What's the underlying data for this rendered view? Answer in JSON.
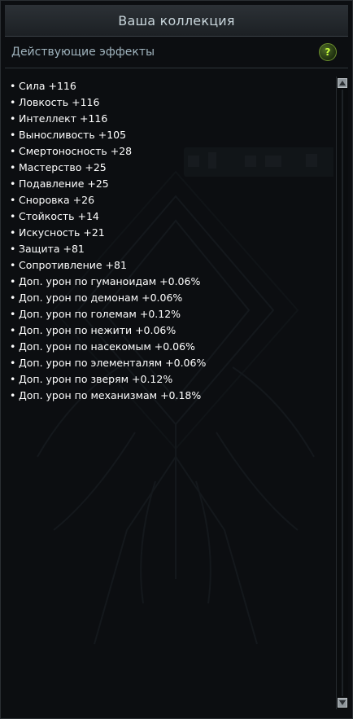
{
  "window": {
    "title": "Ваша коллекция"
  },
  "section": {
    "title": "Действующие эффекты",
    "help_label": "?"
  },
  "effects": [
    "Сила +116",
    "Ловкость +116",
    "Интеллект +116",
    "Выносливость +105",
    "Смертоносность +28",
    "Мастерство +25",
    "Подавление +25",
    "Сноровка +26",
    "Стойкость +14",
    "Искусность +21",
    "Защита +81",
    "Сопротивление +81",
    "Доп. урон по гуманоидам +0.06%",
    "Доп. урон по демонам +0.06%",
    "Доп. урон по големам +0.12%",
    "Доп. урон по нежити +0.06%",
    "Доп. урон по насекомым +0.06%",
    "Доп. урон по элементалям +0.06%",
    "Доп. урон по зверям +0.12%",
    "Доп. урон по механизмам +0.18%"
  ],
  "icons": {
    "help": "question-mark-icon",
    "scroll_up": "arrow-up-icon",
    "scroll_down": "arrow-down-icon",
    "background": "emblem-icon"
  },
  "colors": {
    "panel_bg": "#0c0e11",
    "title_text": "#c9d6dc",
    "section_text": "#9fb3bd",
    "effect_text": "#ffffff",
    "help_accent": "#c9ff3e"
  }
}
